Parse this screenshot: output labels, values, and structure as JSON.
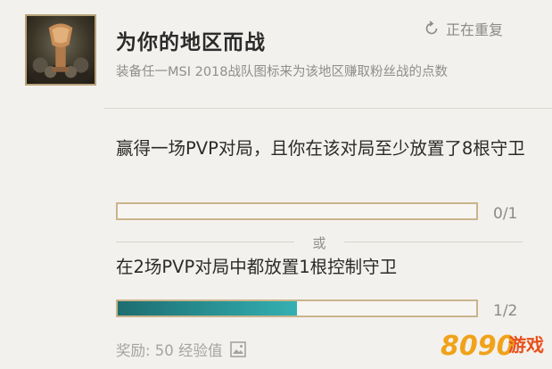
{
  "mission": {
    "title": "为你的地区而战",
    "reroll_label": "正在重复",
    "description": "装备任一MSI 2018战队图标来为该地区赚取粉丝战的点数"
  },
  "objectives": [
    {
      "text": "赢得一场PVP对局，且你在该对局至少放置了8根守卫",
      "progress": "0/1",
      "fraction": 0.0
    },
    {
      "text": "在2场PVP对局中都放置1根控制守卫",
      "progress": "1/2",
      "fraction": 0.5
    }
  ],
  "or_label": "或",
  "reward": {
    "label": "奖励: 50 经验值"
  },
  "watermark": {
    "text": "8090游戏"
  },
  "colors": {
    "progress_fill": "#2a9a9d",
    "bar_border": "#c9b48b",
    "background": "#f3f1ed"
  },
  "icons": {
    "reroll": "refresh-icon",
    "reward": "image-icon",
    "mission": "trophy-emblem-icon"
  }
}
